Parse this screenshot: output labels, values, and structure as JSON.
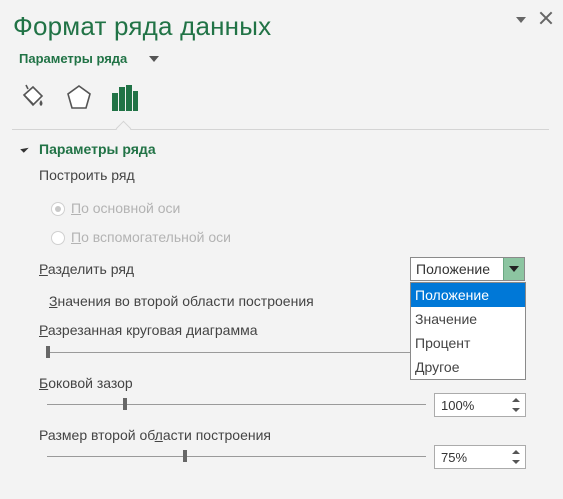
{
  "pane": {
    "title": "Формат ряда данных"
  },
  "subheader": {
    "label": "Параметры ряда"
  },
  "section": {
    "title": "Параметры ряда"
  },
  "plot_series_label": "Построить ряд",
  "radios": [
    {
      "label_underline": "П",
      "label_rest": "о основной оси",
      "checked": true
    },
    {
      "label_underline": "П",
      "label_rest": "о вспомогательной оси",
      "checked": false
    }
  ],
  "split": {
    "label_underline": "Р",
    "label_rest": "азделить ряд",
    "selected": "Положение",
    "options": [
      "Положение",
      "Значение",
      "Процент",
      "Другое"
    ],
    "selected_index": 0
  },
  "second_values": {
    "label_underline": "З",
    "label_rest": "начения во второй области построения"
  },
  "explosion": {
    "label_underline": "Р",
    "label_rest": "азрезанная круговая диаграмма",
    "level": 0.0
  },
  "gap": {
    "label_underline": "Б",
    "label_rest": "оковой зазор",
    "value": "100%",
    "level": 0.2
  },
  "second_size": {
    "label_rest_1": "Размер второй об",
    "label_underline": "л",
    "label_rest_2": "асти построения",
    "value": "75%",
    "level": 0.36
  },
  "colors": {
    "accent": "#217346",
    "selection": "#0078d7",
    "dropdown_button": "#8cc5a1"
  },
  "icons": [
    "fill-line-icon",
    "effects-icon",
    "series-options-icon"
  ]
}
